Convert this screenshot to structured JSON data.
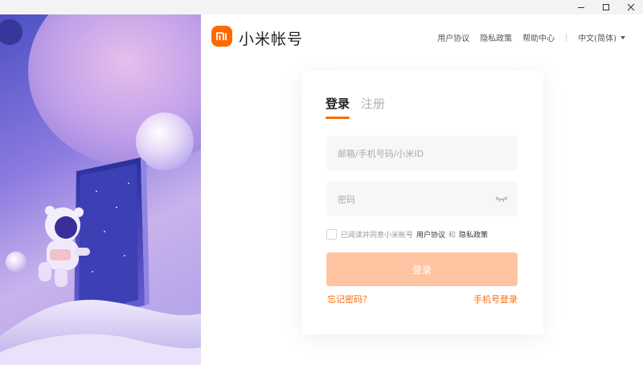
{
  "window": {
    "minimize_icon": "minimize-icon",
    "maximize_icon": "maximize-icon",
    "close_icon": "close-icon"
  },
  "header": {
    "logo_text": "mi",
    "brand_name": "小米帐号",
    "links": [
      "用户协议",
      "隐私政策",
      "帮助中心"
    ],
    "language": "中文(简体)"
  },
  "colors": {
    "accent": "#ff6900",
    "button_disabled": "#ffc4a1",
    "field_bg": "#f7f7f7"
  },
  "login": {
    "tabs": [
      {
        "label": "登录",
        "active": true
      },
      {
        "label": "注册",
        "active": false
      }
    ],
    "account_placeholder": "邮箱/手机号码/小米ID",
    "password_placeholder": "密码",
    "agree_text": "已阅读并同意小米帐号",
    "agree_link_1": "用户协议",
    "agree_and": "和",
    "agree_link_2": "隐私政策",
    "submit_label": "登录",
    "forgot_label": "忘记密码？",
    "phone_login_label": "手机号登录"
  }
}
